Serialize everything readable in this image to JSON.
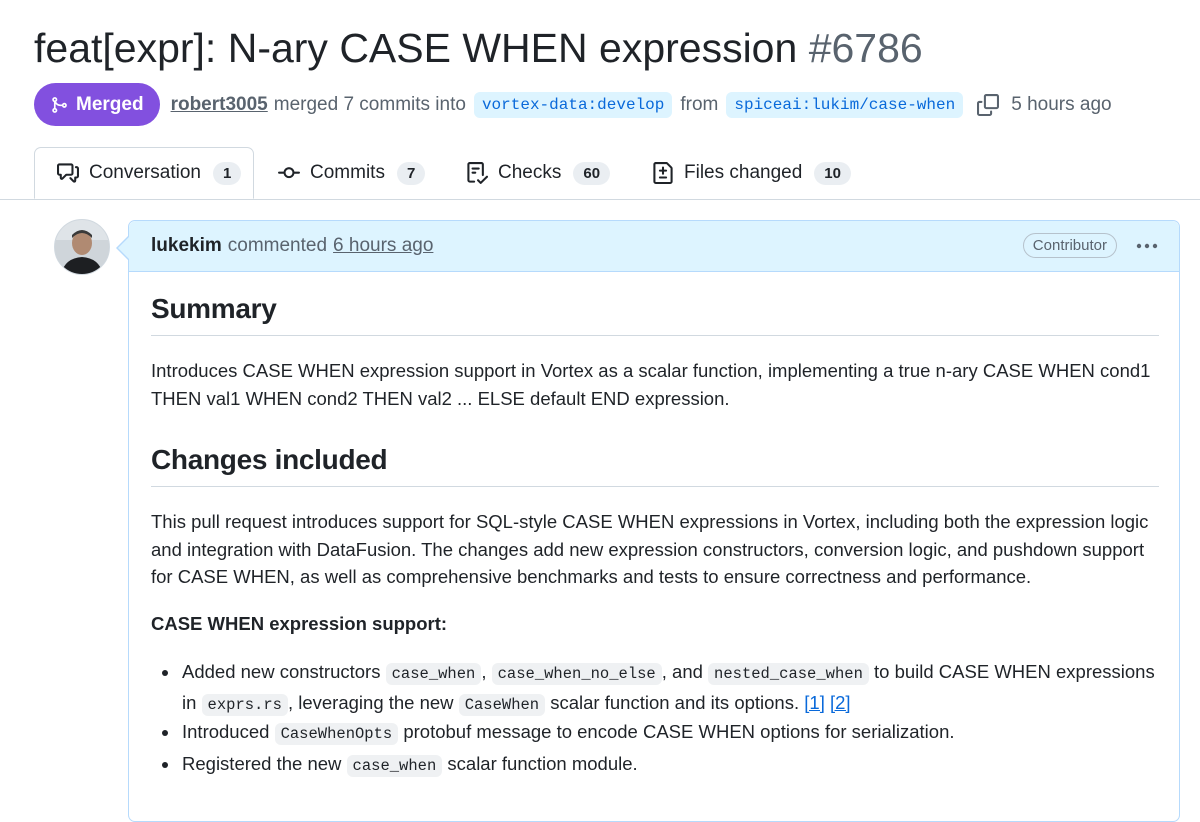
{
  "pr": {
    "title": "feat[expr]: N-ary CASE WHEN expression",
    "number": "#6786",
    "state": "Merged",
    "author": "robert3005",
    "action": "merged 7 commits into",
    "base_branch": "vortex-data:develop",
    "from_word": "from",
    "head_branch": "spiceai:lukim/case-when",
    "time": "5 hours ago"
  },
  "tabs": [
    {
      "label": "Conversation",
      "count": "1",
      "icon": "comment-discussion-icon"
    },
    {
      "label": "Commits",
      "count": "7",
      "icon": "git-commit-icon"
    },
    {
      "label": "Checks",
      "count": "60",
      "icon": "checklist-icon"
    },
    {
      "label": "Files changed",
      "count": "10",
      "icon": "file-diff-icon"
    }
  ],
  "comment": {
    "author": "lukekim",
    "action": "commented",
    "time": "6 hours ago",
    "role": "Contributor",
    "summary_heading": "Summary",
    "summary_text": "Introduces CASE WHEN expression support in Vortex as a scalar function, implementing a true n-ary CASE WHEN cond1 THEN val1 WHEN cond2 THEN val2 ... ELSE default END expression.",
    "changes_heading": "Changes included",
    "changes_text": "This pull request introduces support for SQL-style CASE WHEN expressions in Vortex, including both the expression logic and integration with DataFusion. The changes add new expression constructors, conversion logic, and pushdown support for CASE WHEN, as well as comprehensive benchmarks and tests to ensure correctness and performance.",
    "support_heading": "CASE WHEN expression support:",
    "bullet1": {
      "t1": "Added new constructors ",
      "c1": "case_when",
      "t2": ", ",
      "c2": "case_when_no_else",
      "t3": ", and ",
      "c3": "nested_case_when",
      "t4": " to build CASE WHEN expressions in ",
      "c4": "exprs.rs",
      "t5": ", leveraging the new ",
      "c5": "CaseWhen",
      "t6": " scalar function and its options. ",
      "ref1": "[1]",
      "ref2": "[2]"
    },
    "bullet2": {
      "t1": "Introduced ",
      "c1": "CaseWhenOpts",
      "t2": " protobuf message to encode CASE WHEN options for serialization."
    },
    "bullet3": {
      "t1": "Registered the new ",
      "c1": "case_when",
      "t2": " scalar function module."
    }
  }
}
